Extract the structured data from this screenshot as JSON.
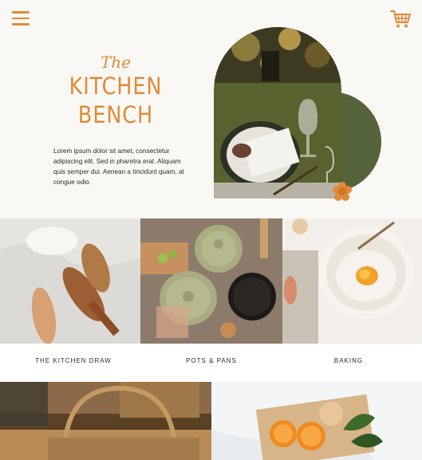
{
  "header": {
    "menu_icon": "hamburger-menu-icon",
    "cart_icon": "shopping-cart-icon"
  },
  "hero": {
    "brand_the": "The",
    "brand_line1": "KITCHEN",
    "brand_line2": "BENCH",
    "description": "Lorem ipsum dolor sit amet, consectetur adipiscing elit. Sed in pharetra erat. Aliquam quis semper dui. Aenean a tincidunt quam, at congue odio."
  },
  "categories": [
    {
      "label": "THE KITCHEN DRAW"
    },
    {
      "label": "POTS & PANS"
    },
    {
      "label": "BAKING"
    }
  ],
  "colors": {
    "accent": "#e08a37",
    "olive": "#55633b",
    "background": "#faf8f5"
  }
}
